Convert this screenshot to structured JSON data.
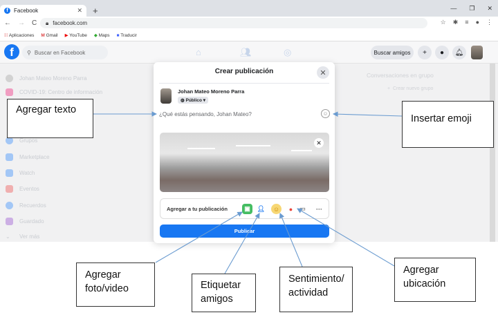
{
  "browser": {
    "tab_title": "Facebook",
    "url": "facebook.com",
    "bookmarks": [
      "Aplicaciones",
      "Gmail",
      "YouTube",
      "Maps",
      "Traducir"
    ]
  },
  "header": {
    "search_placeholder": "Buscar en Facebook",
    "find_friends": "Buscar amigos"
  },
  "sidebar": {
    "items": [
      "Johan Mateo Moreno Parra",
      "COVID-19: Centro de información",
      "Grupos",
      "Marketplace",
      "Watch",
      "Eventos",
      "Recuerdos",
      "Guardado",
      "Ver más"
    ]
  },
  "right": {
    "conversations": "Conversaciones en grupo",
    "create_group": "Crear nuevo grupo"
  },
  "modal": {
    "title": "Crear publicación",
    "user": "Johan Mateo Moreno Parra",
    "privacy": "Público",
    "placeholder": "¿Qué estás pensando, Johan Mateo?",
    "add_to_post": "Agregar a tu publicación",
    "publish": "Publicar"
  },
  "annotations": {
    "text": "Agregar texto",
    "emoji": "Insertar emoji",
    "photo": "Agregar foto/video",
    "tag": "Etiquetar amigos",
    "feeling": "Sentimiento/ actividad",
    "location": "Agregar ubicación"
  },
  "colors": {
    "brand": "#1877f2",
    "arrow": "#6a9bd0"
  }
}
